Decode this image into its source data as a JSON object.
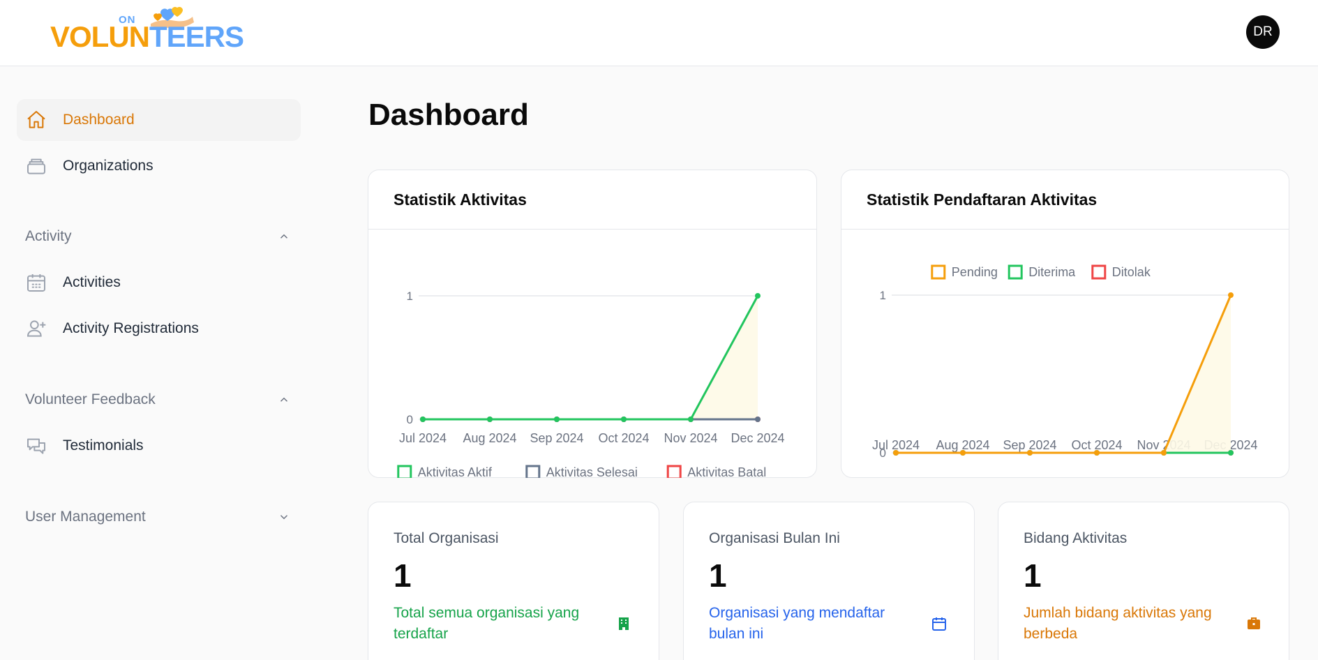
{
  "header": {
    "logo": {
      "on": "ON",
      "part1": "VOLUN",
      "part2": "TEERS"
    },
    "avatar_initials": "DR"
  },
  "sidebar": {
    "items": [
      {
        "label": "Dashboard",
        "icon": "home-icon"
      },
      {
        "label": "Organizations",
        "icon": "archive-box-icon"
      }
    ],
    "groups": [
      {
        "label": "Activity",
        "expanded": true,
        "items": [
          {
            "label": "Activities",
            "icon": "calendar-icon"
          },
          {
            "label": "Activity Registrations",
            "icon": "user-plus-icon"
          }
        ]
      },
      {
        "label": "Volunteer Feedback",
        "expanded": true,
        "items": [
          {
            "label": "Testimonials",
            "icon": "chat-bubbles-icon"
          }
        ]
      },
      {
        "label": "User Management",
        "expanded": false,
        "items": []
      }
    ]
  },
  "main": {
    "title": "Dashboard"
  },
  "colors": {
    "accent": "#d97706",
    "green": "#22c55e",
    "gray": "#64748b",
    "red": "#ef4444",
    "orange": "#f59e0b",
    "blue": "#2563eb"
  },
  "charts": {
    "activity": {
      "title": "Statistik Aktivitas"
    },
    "registration": {
      "title": "Statistik Pendaftaran Aktivitas"
    }
  },
  "chart_data": [
    {
      "type": "line",
      "title": "Statistik Aktivitas",
      "categories": [
        "Jul 2024",
        "Aug 2024",
        "Sep 2024",
        "Oct 2024",
        "Nov 2024",
        "Dec 2024"
      ],
      "yticks": [
        "0",
        "1"
      ],
      "ylim": [
        0,
        1
      ],
      "legend_position": "bottom",
      "series": [
        {
          "name": "Aktivitas Aktif",
          "color": "#22c55e",
          "values": [
            0,
            0,
            0,
            0,
            0,
            1
          ]
        },
        {
          "name": "Aktivitas Selesai",
          "color": "#64748b",
          "values": [
            0,
            0,
            0,
            0,
            0,
            0
          ]
        },
        {
          "name": "Aktivitas Batal",
          "color": "#ef4444",
          "values": [
            0,
            0,
            0,
            0,
            0,
            0
          ]
        }
      ]
    },
    {
      "type": "line",
      "title": "Statistik Pendaftaran Aktivitas",
      "categories": [
        "Jul 2024",
        "Aug 2024",
        "Sep 2024",
        "Oct 2024",
        "Nov 2024",
        "Dec 2024"
      ],
      "yticks": [
        "0",
        "1"
      ],
      "ylim": [
        0,
        1
      ],
      "legend_position": "top",
      "series": [
        {
          "name": "Pending",
          "color": "#f59e0b",
          "values": [
            0,
            0,
            0,
            0,
            0,
            1
          ]
        },
        {
          "name": "Diterima",
          "color": "#22c55e",
          "values": [
            0,
            0,
            0,
            0,
            0,
            0
          ]
        },
        {
          "name": "Ditolak",
          "color": "#ef4444",
          "values": [
            0,
            0,
            0,
            0,
            0,
            0
          ]
        }
      ]
    }
  ],
  "stats": [
    {
      "title": "Total Organisasi",
      "value": "1",
      "desc": "Total semua organisasi yang terdaftar",
      "color": "#16a34a",
      "icon": "building-icon"
    },
    {
      "title": "Organisasi Bulan Ini",
      "value": "1",
      "desc": "Organisasi yang mendaftar bulan ini",
      "color": "#2563eb",
      "icon": "calendar-icon"
    },
    {
      "title": "Bidang Aktivitas",
      "value": "1",
      "desc": "Jumlah bidang aktivitas yang berbeda",
      "color": "#d97706",
      "icon": "briefcase-icon"
    }
  ]
}
